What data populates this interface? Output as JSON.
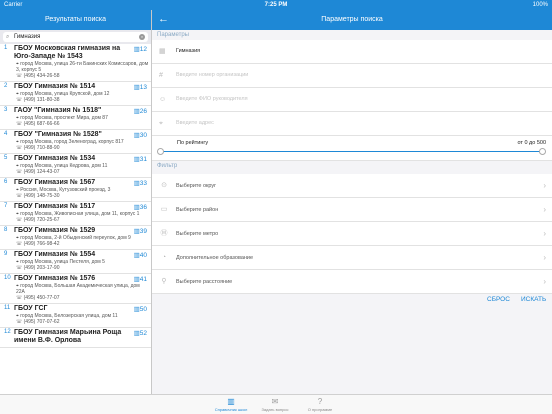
{
  "status": {
    "carrier": "Carrier ︎",
    "time": "7:25 PM",
    "battery": "100%"
  },
  "left": {
    "title": "Результаты поиска",
    "search_value": "Гимназия",
    "results": [
      {
        "num": "1",
        "name": "ГБОУ Московская гимназия на Юго-Западе № 1543",
        "rating": "12",
        "address": "город Москва, улица 26-ти Бакинских Комиссаров, дом 3, корпус 5",
        "phone": "(495) 434-26-58"
      },
      {
        "num": "2",
        "name": "ГБОУ Гимназия № 1514",
        "rating": "13",
        "address": "город Москва, улица Крупской, дом 12",
        "phone": "(499) 131-80-38"
      },
      {
        "num": "3",
        "name": "ГАОУ \"Гимназия № 1518\"",
        "rating": "26",
        "address": "город Москва, проспект Мира, дом 87",
        "phone": "(495) 687-66-66"
      },
      {
        "num": "4",
        "name": "ГБОУ \"Гимназия № 1528\"",
        "rating": "30",
        "address": "город Москва, город Зеленоград, корпус 817",
        "phone": "(499) 710-88-90"
      },
      {
        "num": "5",
        "name": "ГБОУ Гимназия № 1534",
        "rating": "31",
        "address": "город Москва, улица Кедрова, дом 11",
        "phone": "(499) 124-43-07"
      },
      {
        "num": "6",
        "name": "ГБОУ Гимназия № 1567",
        "rating": "33",
        "address": "Россия, Москва, Кутузовский проезд, 3",
        "phone": "(499) 148-75-30"
      },
      {
        "num": "7",
        "name": "ГБОУ Гимназия № 1517",
        "rating": "36",
        "address": "город Москва, Живописная улица, дом 11, корпус 1",
        "phone": "(499) 720-25-67"
      },
      {
        "num": "8",
        "name": "ГБОУ Гимназия № 1529",
        "rating": "39",
        "address": "город Москва, 2-й Обыденский переулок, дом 9",
        "phone": "(499) 766-98-42"
      },
      {
        "num": "9",
        "name": "ГБОУ Гимназия № 1554",
        "rating": "40",
        "address": "город Москва, улица Пестеля, дом 5",
        "phone": "(499) 203-17-90"
      },
      {
        "num": "10",
        "name": "ГБОУ Гимназия № 1576",
        "rating": "41",
        "address": "город Москва, Большая Академическая улица, дом 22А",
        "phone": "(495) 450-77-07"
      },
      {
        "num": "11",
        "name": "ГБОУ ГСГ",
        "rating": "50",
        "address": "город Москва, Белозерская улица, дом 11",
        "phone": "(495) 707-07-62"
      },
      {
        "num": "12",
        "name": "ГБОУ Гимназия Марьина Роща имени В.Ф. Орлова",
        "rating": "52",
        "address": "",
        "phone": ""
      }
    ]
  },
  "right": {
    "title": "Параметры поиска",
    "params_label": "Параметры",
    "fields": {
      "name": "Гимназия",
      "org_number_placeholder": "Введите номер организации",
      "director_placeholder": "Введите ФИО руководителя",
      "address_placeholder": "Введите адрес"
    },
    "rating_label": "По рейтингу",
    "rating_range": "от 0 до 500",
    "filter_label": "Фильтр",
    "filters": [
      "Выберите округ",
      "Выберите район",
      "Выберите метро",
      "Дополнительное образование",
      "Выберите расстояние"
    ],
    "reset_label": "СБРОС",
    "search_label": "ИСКАТЬ"
  },
  "tabbar": {
    "tabs": [
      {
        "label": "Справочник школ",
        "active": true
      },
      {
        "label": "Задать вопрос",
        "active": false
      },
      {
        "label": "О программе",
        "active": false
      }
    ]
  },
  "colors": {
    "accent": "#1e88d6"
  }
}
